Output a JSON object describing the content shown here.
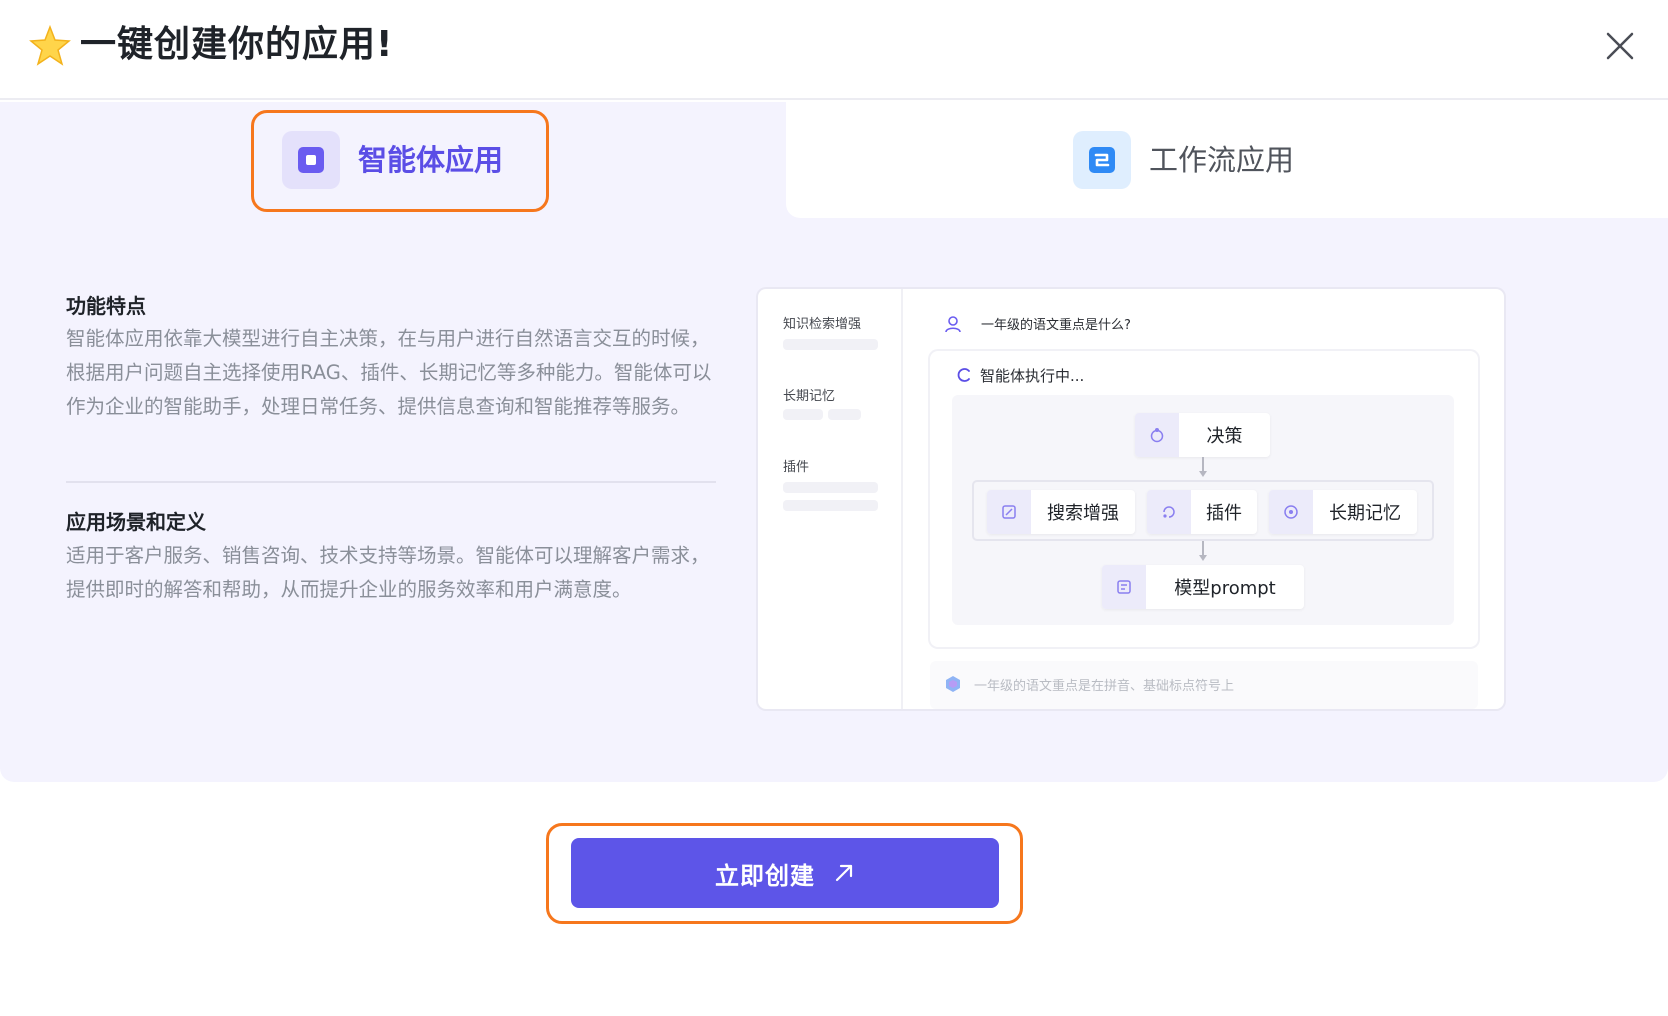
{
  "dialog": {
    "title": "一键创建你的应用!",
    "icons": {
      "title_icon": "star-icon",
      "close": "close-icon"
    }
  },
  "tabs": [
    {
      "label": "智能体应用",
      "icon": "agent-app-icon",
      "selected": true
    },
    {
      "label": "工作流应用",
      "icon": "workflow-app-icon",
      "selected": false
    }
  ],
  "features": {
    "title": "功能特点",
    "text": "智能体应用依靠大模型进行自主决策，在与用户进行自然语言交互的时候，根据用户问题自主选择使用RAG、插件、长期记忆等多种能力。智能体可以作为企业的智能助手，处理日常任务、提供信息查询和智能推荐等服务。"
  },
  "scenarios": {
    "title": "应用场景和定义",
    "text": "适用于客户服务、销售咨询、技术支持等场景。智能体可以理解客户需求，提供即时的解答和帮助，从而提升企业的服务效率和用户满意度。"
  },
  "preview": {
    "sidebar": [
      "知识检索增强",
      "长期记忆",
      "插件"
    ],
    "question": "一年级的语文重点是什么?",
    "status": "智能体执行中...",
    "nodes": {
      "decision": "决策",
      "search": "搜索增强",
      "plugin": "插件",
      "memory": "长期记忆",
      "model": "模型prompt"
    },
    "answer": "一年级的语文重点是在拼音、基础标点符号上"
  },
  "actions": {
    "create_label": "立即创建"
  },
  "colors": {
    "accent": "#5d55e8",
    "panel_bg": "#f4f3fe",
    "highlight": "#f6771d",
    "text_muted": "#8a8f99"
  }
}
